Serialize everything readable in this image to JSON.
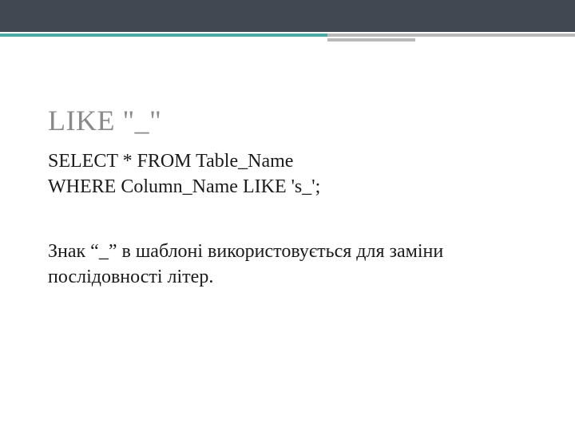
{
  "title": "LIKE \"_\"",
  "code": {
    "line1": "SELECT * FROM Table_Name",
    "line2": "WHERE Column_Name  LIKE 's_';"
  },
  "description": "Знак  “_” в шаблоні використовується для заміни послідовності літер."
}
